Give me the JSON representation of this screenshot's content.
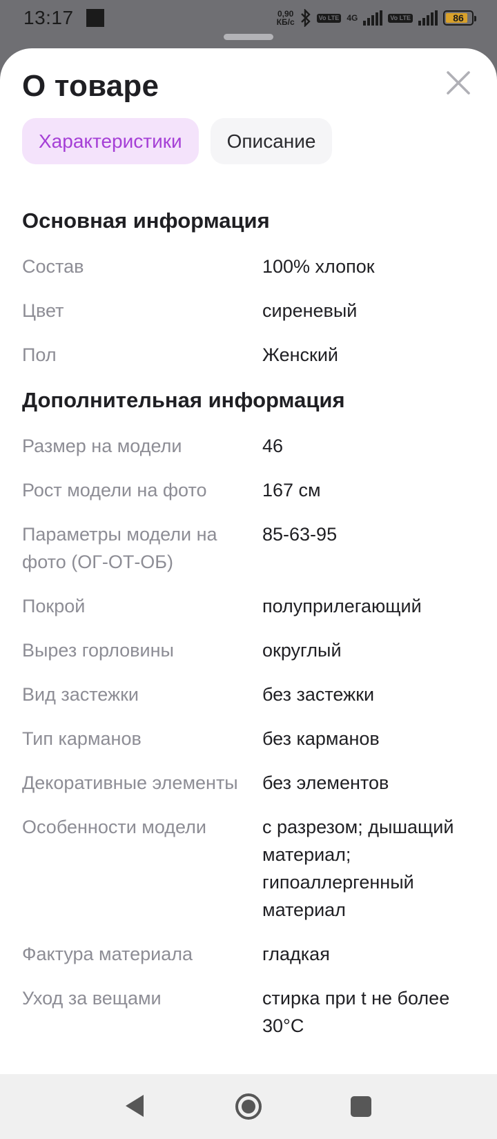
{
  "status_bar": {
    "time": "13:17",
    "net_speed_value": "0,90",
    "net_speed_unit": "КБ/с",
    "volte_badge": "Vo LTE",
    "network_label": "4G",
    "battery": "86",
    "battery_level": 0.86
  },
  "sheet": {
    "title": "О товаре"
  },
  "tabs": [
    {
      "label": "Характеристики",
      "active": true
    },
    {
      "label": "Описание",
      "active": false
    }
  ],
  "sections": [
    {
      "title": "Основная информация",
      "rows": [
        {
          "label": "Состав",
          "value": "100% хлопок"
        },
        {
          "label": "Цвет",
          "value": "сиреневый"
        },
        {
          "label": "Пол",
          "value": "Женский"
        }
      ]
    },
    {
      "title": "Дополнительная информация",
      "rows": [
        {
          "label": "Размер на модели",
          "value": "46"
        },
        {
          "label": "Рост модели на фото",
          "value": "167 см"
        },
        {
          "label": "Параметры модели на фото (ОГ-ОТ-ОБ)",
          "value": "85-63-95"
        },
        {
          "label": "Покрой",
          "value": "полуприлегающий"
        },
        {
          "label": "Вырез горловины",
          "value": "округлый"
        },
        {
          "label": "Вид застежки",
          "value": "без застежки"
        },
        {
          "label": "Тип карманов",
          "value": "без карманов"
        },
        {
          "label": "Декоративные элементы",
          "value": "без элементов"
        },
        {
          "label": "Особенности модели",
          "value": "с разрезом; дышащий материал; гипоаллергенный материал"
        },
        {
          "label": "Фактура материала",
          "value": "гладкая"
        },
        {
          "label": "Уход за вещами",
          "value": "стирка при t не более 30°С"
        }
      ]
    }
  ],
  "colors": {
    "accent": "#a53fd6",
    "active_tab_bg": "#f4e3fb",
    "label_gray": "#8d8d95"
  }
}
